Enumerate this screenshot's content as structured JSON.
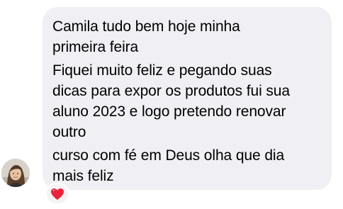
{
  "message": {
    "lines": [
      "Camila tudo bem hoje minha",
      "primeira feira",
      "Fiquei muito feliz e pegando suas",
      "dicas para expor os produtos fui sua",
      "aluno 2023 e logo pretendo renovar",
      "outro",
      "curso com fé em Deus olha que dia",
      "mais feliz"
    ]
  },
  "reaction": {
    "icon": "heart-icon",
    "color": "#e8233a"
  },
  "sender": {
    "avatar_icon": "avatar"
  },
  "colors": {
    "bubble_bg": "#efeff4",
    "text": "#000000",
    "background": "#ffffff"
  }
}
